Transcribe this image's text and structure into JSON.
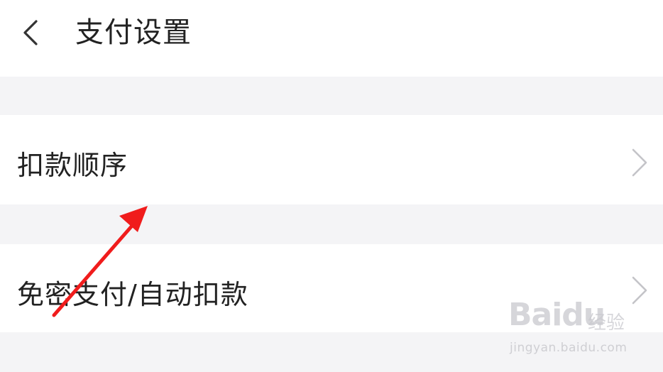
{
  "header": {
    "title": "支付设置",
    "back_icon": "chevron-left-icon"
  },
  "settings": {
    "items": [
      {
        "label": "扣款顺序",
        "icon": "chevron-right-icon"
      },
      {
        "label": "免密支付/自动扣款",
        "icon": "chevron-right-icon"
      }
    ]
  },
  "annotation": {
    "color": "#f01c1c",
    "icon": "red-arrow"
  },
  "watermark": {
    "logo": "Baidu",
    "suffix": "经验",
    "url": "jingyan.baidu.com"
  },
  "colors": {
    "background": "#f4f4f6",
    "surface": "#ffffff",
    "text": "#222222",
    "chevron": "#c4c4c8"
  }
}
